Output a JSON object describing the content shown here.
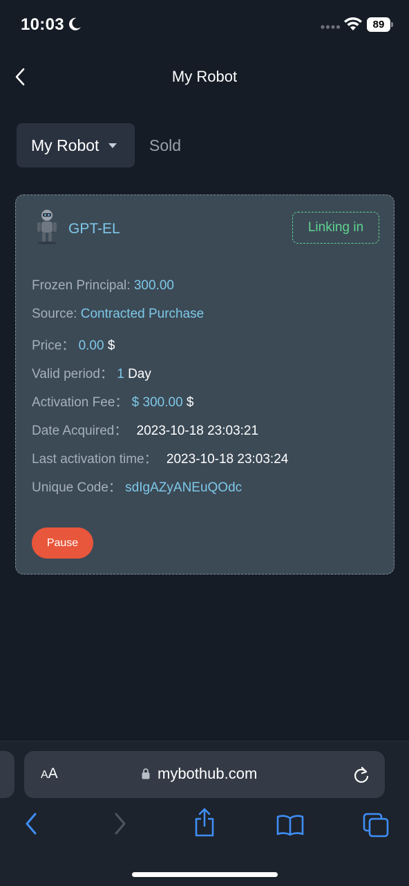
{
  "status_bar": {
    "time": "10:03",
    "battery": "89"
  },
  "header": {
    "title": "My Robot"
  },
  "tabs": {
    "active_label": "My Robot",
    "inactive_label": "Sold"
  },
  "robot": {
    "name": "GPT-EL",
    "status": "Linking in",
    "rows": {
      "frozen_principal": {
        "label": "Frozen Principal: ",
        "value": "300.00"
      },
      "source": {
        "label": "Source: ",
        "value": "Contracted Purchase"
      },
      "price": {
        "label": "Price： ",
        "value": "0.00",
        "suffix": " $"
      },
      "valid_period": {
        "label": "Valid period： ",
        "value": "1",
        "suffix": " Day"
      },
      "activation_fee": {
        "label": "Activation Fee： ",
        "value": "$ 300.00",
        "suffix": " $"
      },
      "date_acquired": {
        "label": "Date Acquired： ",
        "value": "2023-10-18 23:03:21"
      },
      "last_activation": {
        "label": "Last activation time： ",
        "value": "2023-10-18 23:03:24"
      },
      "unique_code": {
        "label": "Unique Code： ",
        "value": "sdIgAZyANEuQOdc"
      }
    },
    "pause_label": "Pause"
  },
  "browser": {
    "aa_small": "A",
    "aa_large": "A",
    "url": "mybothub.com"
  },
  "colors": {
    "background": "#161c26",
    "card": "#3c4a56",
    "accent_blue": "#7ec8e8",
    "status_green": "#5fd590",
    "pause_red": "#e8563b"
  }
}
